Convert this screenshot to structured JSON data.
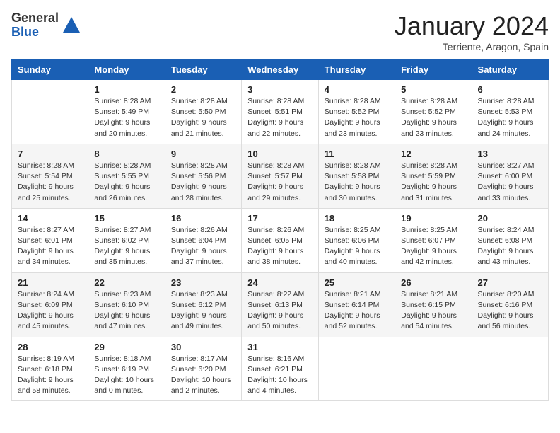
{
  "header": {
    "logo_general": "General",
    "logo_blue": "Blue",
    "month_title": "January 2024",
    "subtitle": "Terriente, Aragon, Spain"
  },
  "weekdays": [
    "Sunday",
    "Monday",
    "Tuesday",
    "Wednesday",
    "Thursday",
    "Friday",
    "Saturday"
  ],
  "weeks": [
    [
      {
        "day": "",
        "info": ""
      },
      {
        "day": "1",
        "info": "Sunrise: 8:28 AM\nSunset: 5:49 PM\nDaylight: 9 hours\nand 20 minutes."
      },
      {
        "day": "2",
        "info": "Sunrise: 8:28 AM\nSunset: 5:50 PM\nDaylight: 9 hours\nand 21 minutes."
      },
      {
        "day": "3",
        "info": "Sunrise: 8:28 AM\nSunset: 5:51 PM\nDaylight: 9 hours\nand 22 minutes."
      },
      {
        "day": "4",
        "info": "Sunrise: 8:28 AM\nSunset: 5:52 PM\nDaylight: 9 hours\nand 23 minutes."
      },
      {
        "day": "5",
        "info": "Sunrise: 8:28 AM\nSunset: 5:52 PM\nDaylight: 9 hours\nand 23 minutes."
      },
      {
        "day": "6",
        "info": "Sunrise: 8:28 AM\nSunset: 5:53 PM\nDaylight: 9 hours\nand 24 minutes."
      }
    ],
    [
      {
        "day": "7",
        "info": "Sunrise: 8:28 AM\nSunset: 5:54 PM\nDaylight: 9 hours\nand 25 minutes."
      },
      {
        "day": "8",
        "info": "Sunrise: 8:28 AM\nSunset: 5:55 PM\nDaylight: 9 hours\nand 26 minutes."
      },
      {
        "day": "9",
        "info": "Sunrise: 8:28 AM\nSunset: 5:56 PM\nDaylight: 9 hours\nand 28 minutes."
      },
      {
        "day": "10",
        "info": "Sunrise: 8:28 AM\nSunset: 5:57 PM\nDaylight: 9 hours\nand 29 minutes."
      },
      {
        "day": "11",
        "info": "Sunrise: 8:28 AM\nSunset: 5:58 PM\nDaylight: 9 hours\nand 30 minutes."
      },
      {
        "day": "12",
        "info": "Sunrise: 8:28 AM\nSunset: 5:59 PM\nDaylight: 9 hours\nand 31 minutes."
      },
      {
        "day": "13",
        "info": "Sunrise: 8:27 AM\nSunset: 6:00 PM\nDaylight: 9 hours\nand 33 minutes."
      }
    ],
    [
      {
        "day": "14",
        "info": "Sunrise: 8:27 AM\nSunset: 6:01 PM\nDaylight: 9 hours\nand 34 minutes."
      },
      {
        "day": "15",
        "info": "Sunrise: 8:27 AM\nSunset: 6:02 PM\nDaylight: 9 hours\nand 35 minutes."
      },
      {
        "day": "16",
        "info": "Sunrise: 8:26 AM\nSunset: 6:04 PM\nDaylight: 9 hours\nand 37 minutes."
      },
      {
        "day": "17",
        "info": "Sunrise: 8:26 AM\nSunset: 6:05 PM\nDaylight: 9 hours\nand 38 minutes."
      },
      {
        "day": "18",
        "info": "Sunrise: 8:25 AM\nSunset: 6:06 PM\nDaylight: 9 hours\nand 40 minutes."
      },
      {
        "day": "19",
        "info": "Sunrise: 8:25 AM\nSunset: 6:07 PM\nDaylight: 9 hours\nand 42 minutes."
      },
      {
        "day": "20",
        "info": "Sunrise: 8:24 AM\nSunset: 6:08 PM\nDaylight: 9 hours\nand 43 minutes."
      }
    ],
    [
      {
        "day": "21",
        "info": "Sunrise: 8:24 AM\nSunset: 6:09 PM\nDaylight: 9 hours\nand 45 minutes."
      },
      {
        "day": "22",
        "info": "Sunrise: 8:23 AM\nSunset: 6:10 PM\nDaylight: 9 hours\nand 47 minutes."
      },
      {
        "day": "23",
        "info": "Sunrise: 8:23 AM\nSunset: 6:12 PM\nDaylight: 9 hours\nand 49 minutes."
      },
      {
        "day": "24",
        "info": "Sunrise: 8:22 AM\nSunset: 6:13 PM\nDaylight: 9 hours\nand 50 minutes."
      },
      {
        "day": "25",
        "info": "Sunrise: 8:21 AM\nSunset: 6:14 PM\nDaylight: 9 hours\nand 52 minutes."
      },
      {
        "day": "26",
        "info": "Sunrise: 8:21 AM\nSunset: 6:15 PM\nDaylight: 9 hours\nand 54 minutes."
      },
      {
        "day": "27",
        "info": "Sunrise: 8:20 AM\nSunset: 6:16 PM\nDaylight: 9 hours\nand 56 minutes."
      }
    ],
    [
      {
        "day": "28",
        "info": "Sunrise: 8:19 AM\nSunset: 6:18 PM\nDaylight: 9 hours\nand 58 minutes."
      },
      {
        "day": "29",
        "info": "Sunrise: 8:18 AM\nSunset: 6:19 PM\nDaylight: 10 hours\nand 0 minutes."
      },
      {
        "day": "30",
        "info": "Sunrise: 8:17 AM\nSunset: 6:20 PM\nDaylight: 10 hours\nand 2 minutes."
      },
      {
        "day": "31",
        "info": "Sunrise: 8:16 AM\nSunset: 6:21 PM\nDaylight: 10 hours\nand 4 minutes."
      },
      {
        "day": "",
        "info": ""
      },
      {
        "day": "",
        "info": ""
      },
      {
        "day": "",
        "info": ""
      }
    ]
  ]
}
